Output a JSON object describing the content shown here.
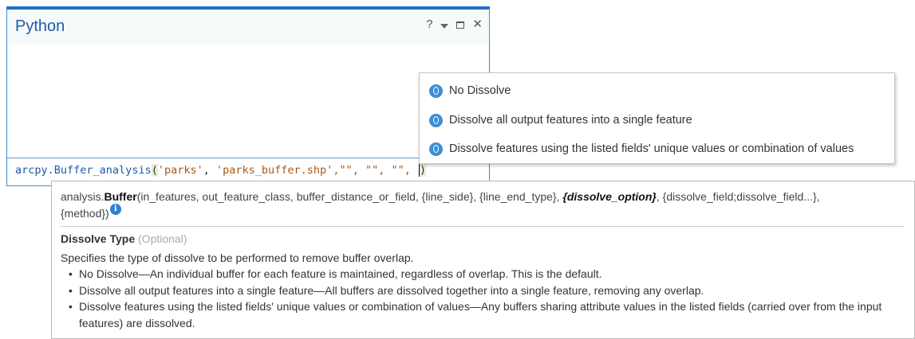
{
  "python_pane": {
    "title": "Python",
    "controls": {
      "help": "?",
      "close": "✕"
    },
    "input": {
      "module": "arcpy.",
      "function": "Buffer_analysis",
      "open_paren": "(",
      "arg1": "'parks'",
      "sep1": ", ",
      "arg2": "'parks_buffer.shp'",
      "rest": ",\"\", \"\", \"\", ",
      "close_paren": ")"
    }
  },
  "dropdown": {
    "items": [
      {
        "label": "No Dissolve"
      },
      {
        "label": "Dissolve all output features into a single feature"
      },
      {
        "label": "Dissolve features using the listed fields' unique values or combination of values"
      }
    ]
  },
  "tooltip": {
    "signature": {
      "prefix": "analysis.",
      "name": "Buffer",
      "params_before": "(in_features, out_feature_class, buffer_distance_or_field, {line_side}, {line_end_type}, ",
      "active_param": "{dissolve_option}",
      "params_after": ", {dissolve_field;dissolve_field...},",
      "params_line2": "{method})"
    },
    "param_name": "Dissolve Type",
    "param_optional": "(Optional)",
    "description": "Specifies the type of dissolve to be performed to remove buffer overlap.",
    "bullets": [
      "No Dissolve—An individual buffer for each feature is maintained, regardless of overlap. This is the default.",
      "Dissolve all output features into a single feature—All buffers are dissolved together into a single feature, removing any overlap.",
      "Dissolve features using the listed fields' unique values or combination of values—Any buffers sharing attribute values in the listed fields (carried over from the input features) are dissolved."
    ]
  },
  "colors": {
    "accent": "#1f6fc4",
    "radio": "#3d8fd6",
    "string": "#a65a1b"
  }
}
